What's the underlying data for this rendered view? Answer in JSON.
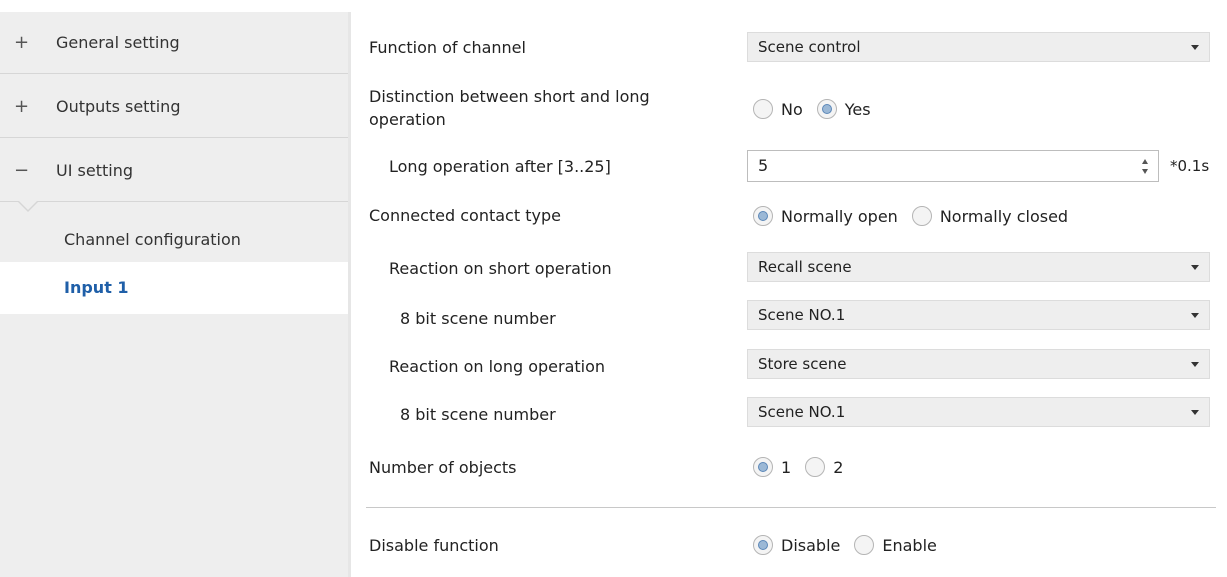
{
  "sidebar": {
    "items": [
      {
        "sign": "+",
        "label": "General setting"
      },
      {
        "sign": "+",
        "label": "Outputs setting"
      },
      {
        "sign": "−",
        "label": "UI setting"
      }
    ],
    "sub_items": [
      {
        "label": "Channel configuration",
        "active": false
      },
      {
        "label": "Input 1",
        "active": true
      }
    ]
  },
  "main": {
    "function_of_channel": {
      "label": "Function of channel",
      "value": "Scene control"
    },
    "distinction": {
      "label_line1": "Distinction between short and long",
      "label_line2": "operation",
      "options": [
        "No",
        "Yes"
      ],
      "selected": "Yes"
    },
    "long_operation": {
      "label": "Long operation after [3..25]",
      "value": "5",
      "unit": "*0.1s"
    },
    "contact_type": {
      "label": "Connected contact type",
      "options": [
        "Normally open",
        "Normally closed"
      ],
      "selected": "Normally open"
    },
    "reaction_short": {
      "label": "Reaction on short operation",
      "value": "Recall scene"
    },
    "scene_number_short": {
      "label": "8 bit scene number",
      "value": "Scene NO.1"
    },
    "reaction_long": {
      "label": "Reaction on long operation",
      "value": "Store scene"
    },
    "scene_number_long": {
      "label": "8 bit scene number",
      "value": "Scene NO.1"
    },
    "number_of_objects": {
      "label": "Number of objects",
      "options": [
        "1",
        "2"
      ],
      "selected": "1"
    },
    "disable_function": {
      "label": "Disable function",
      "options": [
        "Disable",
        "Enable"
      ],
      "selected": "Disable"
    }
  },
  "colors": {
    "active_nav_text": "#1f5fa8",
    "sidebar_bg": "#eeeeee",
    "select_bg": "#eeeeee",
    "radio_on": "#9bb8d6"
  }
}
